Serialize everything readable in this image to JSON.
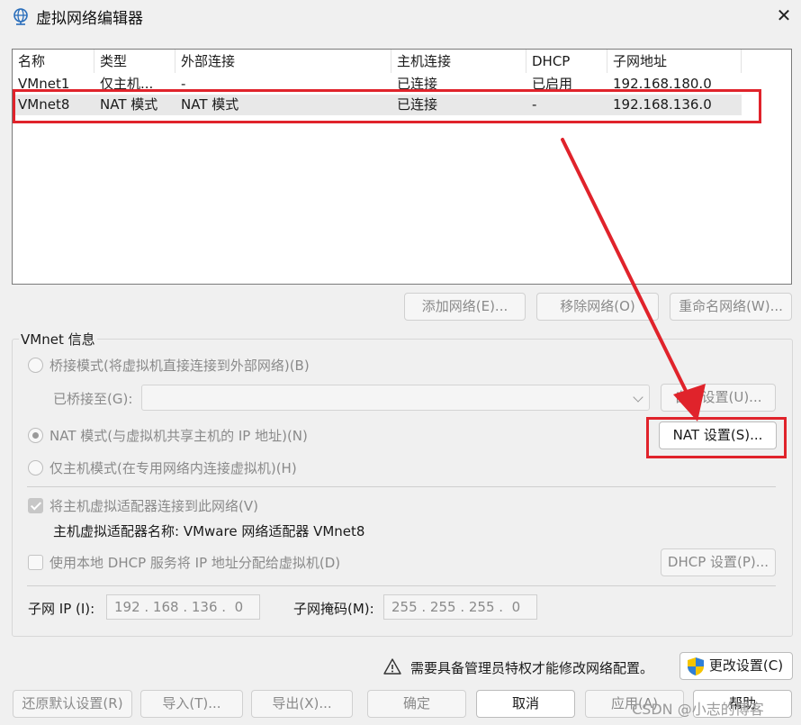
{
  "window": {
    "title": "虚拟网络编辑器",
    "icon": "globe-network-icon",
    "close_icon": "close-icon",
    "close_glyph": "✕"
  },
  "network_list": {
    "columns": [
      "名称",
      "类型",
      "外部连接",
      "主机连接",
      "DHCP",
      "子网地址"
    ],
    "rows": [
      {
        "name": "VMnet1",
        "type": "仅主机...",
        "external": "-",
        "host": "已连接",
        "dhcp": "已启用",
        "subnet": "192.168.180.0"
      },
      {
        "name": "VMnet8",
        "type": "NAT 模式",
        "external": "NAT 模式",
        "host": "已连接",
        "dhcp": "-",
        "subnet": "192.168.136.0"
      }
    ],
    "selected_row": "VMnet8"
  },
  "list_buttons": {
    "add": "添加网络(E)...",
    "remove": "移除网络(O)",
    "rename": "重命名网络(W)..."
  },
  "vmnet_info": {
    "legend": "VMnet 信息",
    "bridged_label": "桥接模式(将虚拟机直接连接到外部网络)(B)",
    "bridged_to_label": "已桥接至(G):",
    "bridged_to_value": "",
    "auto_settings": "自动设置(U)...",
    "nat_label": "NAT 模式(与虚拟机共享主机的 IP 地址)(N)",
    "nat_settings": "NAT 设置(S)...",
    "hostonly_label": "仅主机模式(在专用网络内连接虚拟机)(H)",
    "connect_adapter_label": "将主机虚拟适配器连接到此网络(V)",
    "adapter_name_label": "主机虚拟适配器名称: VMware 网络适配器 VMnet8",
    "dhcp_label": "使用本地 DHCP 服务将 IP 地址分配给虚拟机(D)",
    "dhcp_settings": "DHCP 设置(P)...",
    "subnet_ip_label": "子网 IP (I):",
    "subnet_ip_value": "192 . 168 . 136 .  0",
    "subnet_mask_label": "子网掩码(M):",
    "subnet_mask_value": "255 . 255 . 255 .  0",
    "selected_mode": "nat",
    "connect_adapter_checked": true,
    "dhcp_checked": false
  },
  "admin_notice": {
    "icon": "warning-icon",
    "text": "需要具备管理员特权才能修改网络配置。",
    "change_settings": "更改设置(C)",
    "change_icon": "uac-shield-icon"
  },
  "footer_buttons": {
    "restore_defaults": "还原默认设置(R)",
    "import": "导入(T)...",
    "export": "导出(X)...",
    "ok": "确定",
    "cancel": "取消",
    "apply": "应用(A)",
    "help": "帮助"
  },
  "watermark": "CSDN @小志的博客",
  "colors": {
    "annotation_red": "#e0232b",
    "uac_blue": "#2f7fd8",
    "uac_yellow": "#f5c400"
  }
}
